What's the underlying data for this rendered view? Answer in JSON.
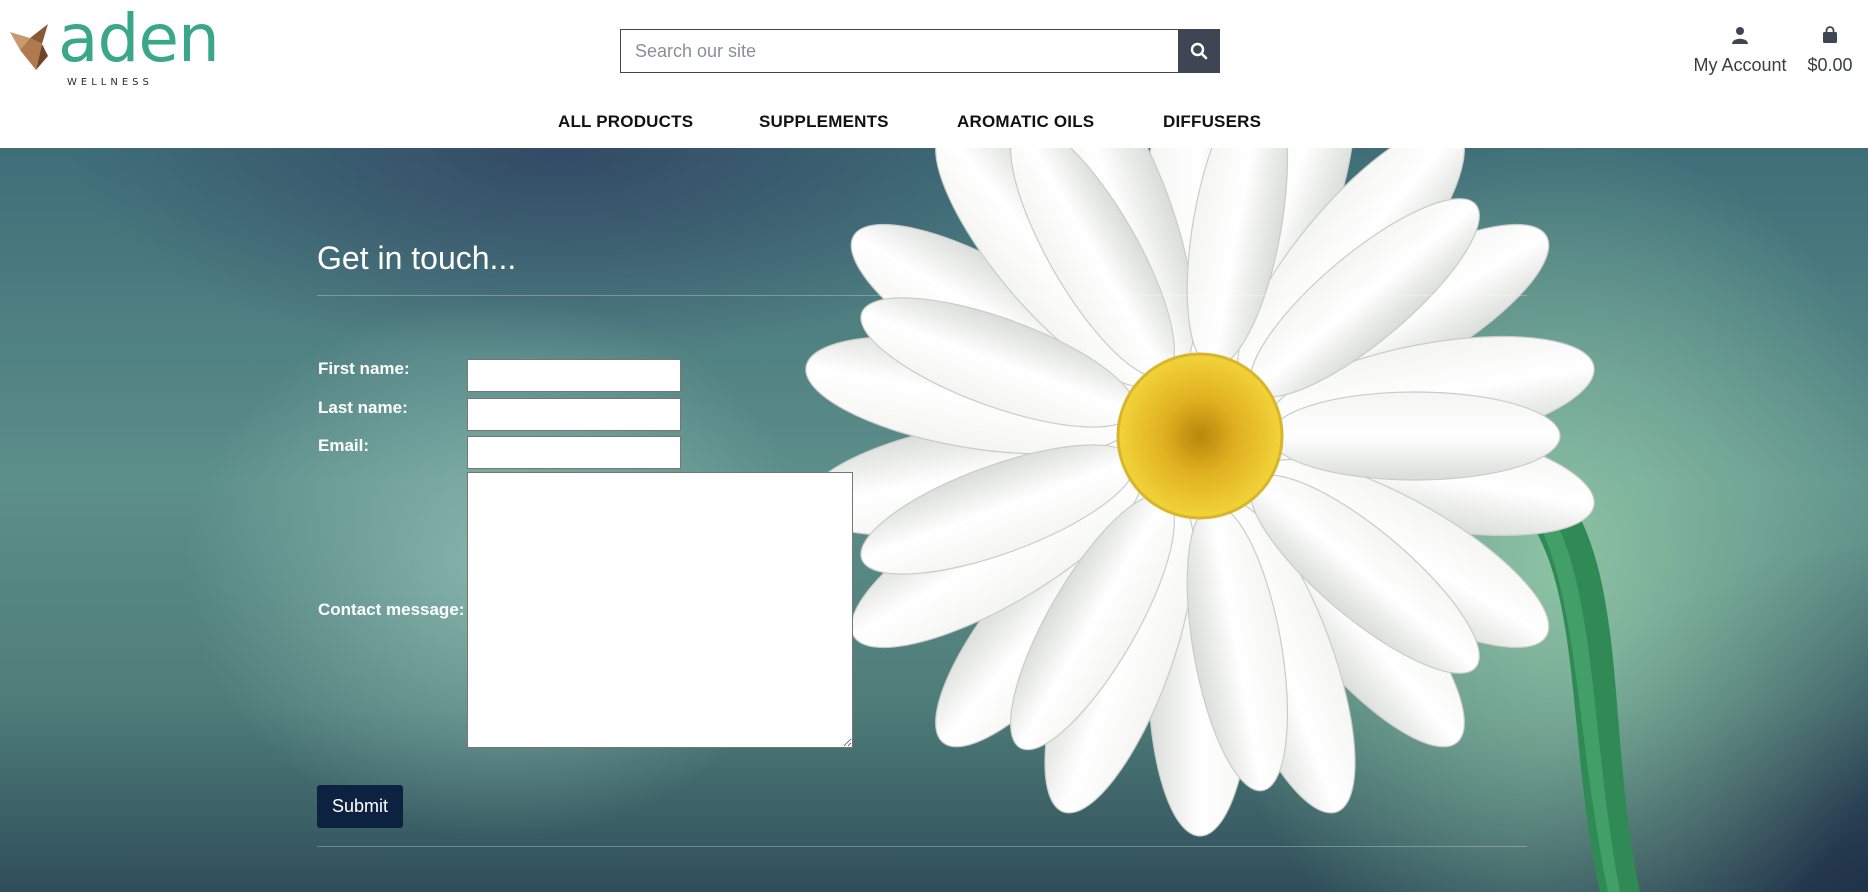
{
  "brand": {
    "name": "aden",
    "tagline": "WELLNESS",
    "colors": {
      "primary": "#3aa68a",
      "accent": "#b07a4e",
      "button_dark": "#0d2240"
    }
  },
  "search": {
    "placeholder": "Search our site",
    "icon": "search-icon"
  },
  "account": {
    "label": "My Account",
    "icon": "person-icon"
  },
  "cart": {
    "label": "$0.00",
    "icon": "shopping-bag-icon"
  },
  "nav": {
    "items": [
      {
        "label": "ALL PRODUCTS"
      },
      {
        "label": "SUPPLEMENTS"
      },
      {
        "label": "AROMATIC OILS"
      },
      {
        "label": "DIFFUSERS"
      }
    ]
  },
  "contact": {
    "heading": "Get in touch...",
    "fields": {
      "first_name": {
        "label": "First name:",
        "value": ""
      },
      "last_name": {
        "label": "Last name:",
        "value": ""
      },
      "email": {
        "label": "Email:",
        "value": ""
      },
      "message": {
        "label": "Contact message:",
        "value": ""
      }
    },
    "submit_label": "Submit"
  }
}
